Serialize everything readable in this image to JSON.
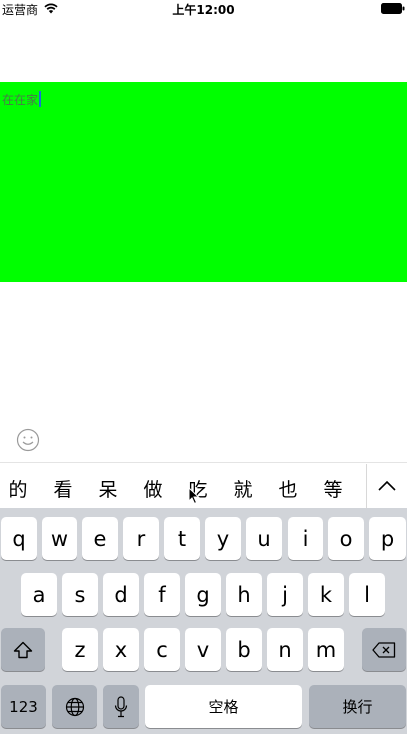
{
  "status_bar": {
    "carrier": "运营商",
    "time": "上午12:00",
    "wifi_icon": "wifi-icon",
    "battery_icon": "battery-icon"
  },
  "editor": {
    "text": "在在家",
    "background": "#00ff00"
  },
  "emoji_icon": "smiley-icon",
  "candidates": [
    "的",
    "看",
    "呆",
    "做",
    "吃",
    "就",
    "也",
    "等"
  ],
  "candidate_expand_icon": "chevron-up-icon",
  "keyboard": {
    "row1": [
      "q",
      "w",
      "e",
      "r",
      "t",
      "y",
      "u",
      "i",
      "o",
      "p"
    ],
    "row2": [
      "a",
      "s",
      "d",
      "f",
      "g",
      "h",
      "j",
      "k",
      "l"
    ],
    "row3": [
      "z",
      "x",
      "c",
      "v",
      "b",
      "n",
      "m"
    ],
    "shift_icon": "shift-icon",
    "delete_icon": "backspace-icon",
    "numbers_label": "123",
    "globe_icon": "globe-icon",
    "mic_icon": "microphone-icon",
    "space_label": "空格",
    "return_label": "换行"
  }
}
